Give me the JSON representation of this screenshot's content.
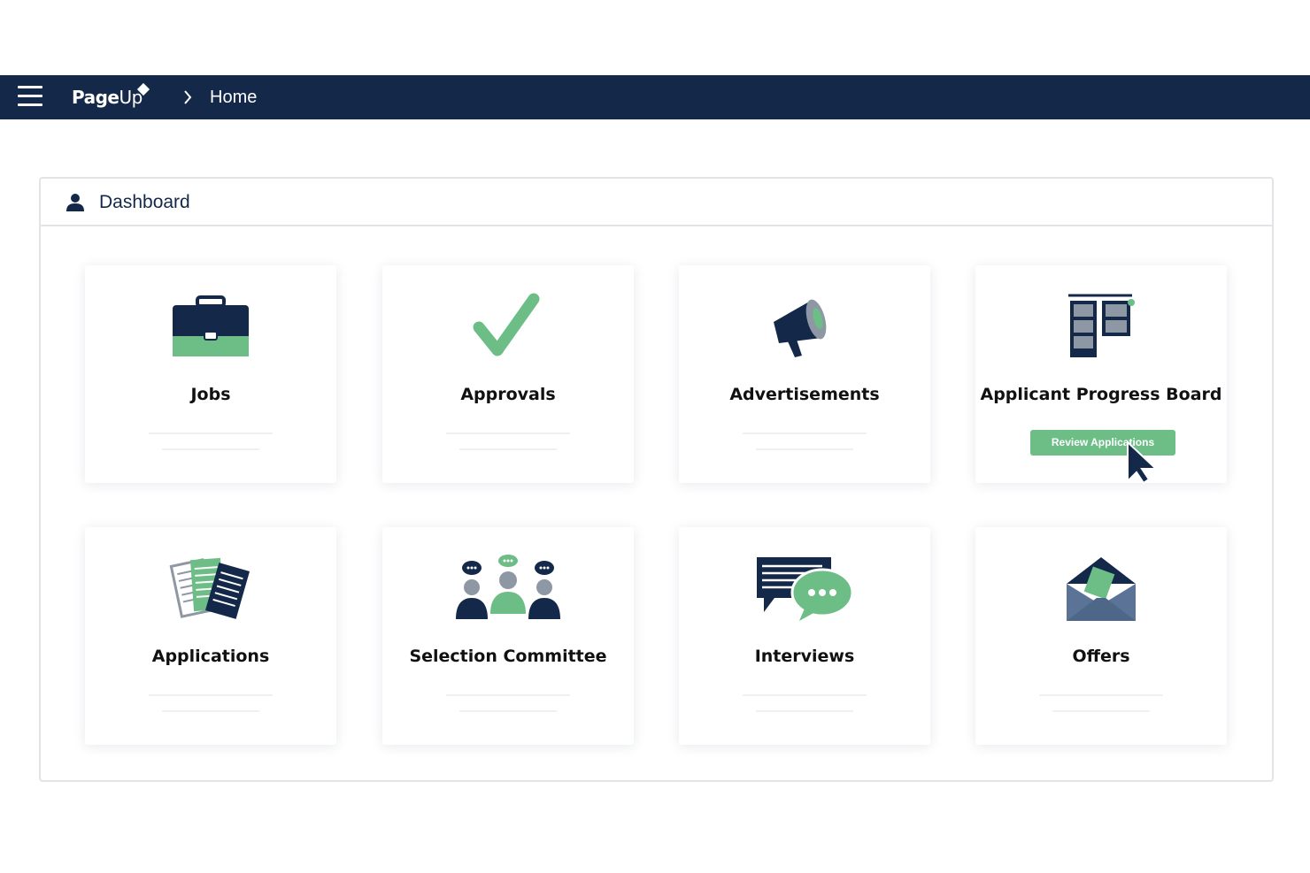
{
  "header": {
    "logo_main": "Page",
    "logo_up": "Up",
    "breadcrumb_home": "Home"
  },
  "dashboard": {
    "title": "Dashboard",
    "tiles": [
      {
        "label": "Jobs",
        "icon": "briefcase-icon"
      },
      {
        "label": "Approvals",
        "icon": "checkmark-icon"
      },
      {
        "label": "Advertisements",
        "icon": "megaphone-icon"
      },
      {
        "label": "Applicant Progress Board",
        "icon": "board-icon",
        "button": "Review Applications"
      },
      {
        "label": "Applications",
        "icon": "documents-icon"
      },
      {
        "label": "Selection Committee",
        "icon": "people-icon"
      },
      {
        "label": "Interviews",
        "icon": "chat-icon"
      },
      {
        "label": "Offers",
        "icon": "envelope-icon"
      }
    ]
  },
  "colors": {
    "navy": "#14294a",
    "green": "#6cbd86",
    "grey": "#8e97a4"
  }
}
